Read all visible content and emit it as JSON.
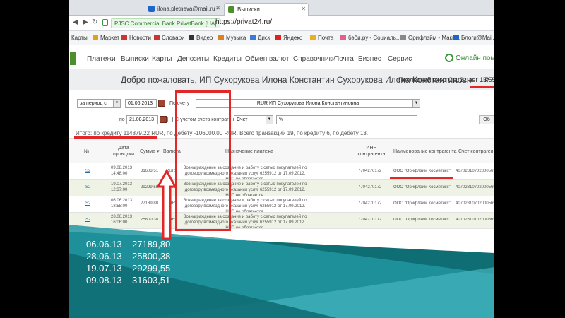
{
  "browser": {
    "tabs": [
      {
        "label": "ilona.pletneva@mail.ru -",
        "icon": "mail-icon",
        "color": "#1e67c7"
      },
      {
        "label": "Выписки",
        "icon": "privat-icon",
        "color": "#4d8f2c"
      }
    ],
    "cert_label": "PJSC Commercial Bank PrivatBank [UA]",
    "url": "https://privat24.ru/",
    "bookmarks": [
      "Карты",
      "Маркет",
      "Новости",
      "Словари",
      "Видео",
      "Музыка",
      "Диск",
      "Яндекс",
      "Почта",
      "бэби.ру - Социаль...",
      "Орифлэйм - Маки...",
      "Блоги@Mail.R"
    ]
  },
  "bank": {
    "menu": [
      "Платежи",
      "Выписки",
      "Карты",
      "Депозиты",
      "Кредиты",
      "Обмен валют",
      "Справочники",
      "Почта",
      "Бизнес",
      "Сервис"
    ],
    "help_label": "Онлайн помо",
    "welcome": "Добро пожаловать, ИП Сухорукова Илона Константин Сухорукова Илона Константиновн",
    "last_login": "Последний вход Ср, 21 авг 13:55",
    "ip_label": "IP",
    "filters": {
      "period_select": "за период с",
      "date_from": "01.06.2013",
      "by_account_label": "По счету",
      "account_value": "RUR ИП Сухорукова Илона Константиновна",
      "to_label": "по",
      "date_to": "21.08.2013",
      "counterparty_label": "С учетом счета контрагента",
      "account_type": "Счет",
      "percent": "%",
      "button": "Об"
    },
    "totals": "Итого: по кредиту 114879.22 RUR, по дебету -106000.00 RUR. Всего транзакций 19, по кредиту 6, по дебету 13.",
    "columns": {
      "num": "№",
      "date": "Дата\nпроводки",
      "sum": "Сумма",
      "currency": "Валюта",
      "purpose": "Назначение платежа",
      "inn": "ИНН\nконтрагента",
      "counterparty": "Наименование контрагента",
      "account": "Счет контраген"
    },
    "rows": [
      {
        "num": "S2",
        "date": "09.08.2013",
        "time": "14:48:00",
        "sum": "31603.51",
        "currency": "RUR",
        "purpose": "Вознаграждение за создание и работу с сетью покупателей по договору возмездного оказания услуг 6255912 от 17.09.2012. НДС не облагается.",
        "inn": "7704270172",
        "counterparty": "ООО \"Орифлэйм Косметикс\"",
        "account": "40702810702000569"
      },
      {
        "num": "S2",
        "date": "19.07.2013",
        "time": "12:37:00",
        "sum": "29299.55",
        "currency": "RUR",
        "purpose": "Вознаграждение за создание и работу с сетью покупателей по договору возмездного оказания услуг 6255912 от 17.09.2012. НДС не облагается.",
        "inn": "7704270172",
        "counterparty": "ООО \"Орифлэйм Косметикс\"",
        "account": "40702810702000569"
      },
      {
        "num": "S2",
        "date": "06.06.2013",
        "time": "18:58:00",
        "sum": "27189.80",
        "currency": "RUR",
        "purpose": "Вознаграждение за создание и работу с сетью покупателей по договору возмездного оказания услуг 6255912 от 17.09.2012. НДС не облагается.",
        "inn": "7704270172",
        "counterparty": "ООО \"Орифлэйм Косметикс\"",
        "account": "40702810702000569"
      },
      {
        "num": "S2",
        "date": "28.06.2013",
        "time": "16:06:00",
        "sum": "25800.38",
        "currency": "RUR",
        "purpose": "Вознаграждение за создание и работу с сетью покупателей по договору возмездного оказания услуг 6255912 от 17.09.2012. НДС не облагается.",
        "inn": "7704270172",
        "counterparty": "ООО \"Орифлэйм Косметикс\"",
        "account": "40702810702000569"
      }
    ]
  },
  "annotations": {
    "color": "#e12727",
    "dates": [
      "06.06.13 – 27189,80",
      "28.06.13 – 25800,38",
      "19.07.13 – 29299,55",
      "09.08.13 – 31603,51"
    ]
  },
  "colors": {
    "teal_dark": "#0f6e74",
    "teal_mid": "#2196a0",
    "teal_light": "#44b4bd",
    "bank_green": "#4d8f2c"
  }
}
